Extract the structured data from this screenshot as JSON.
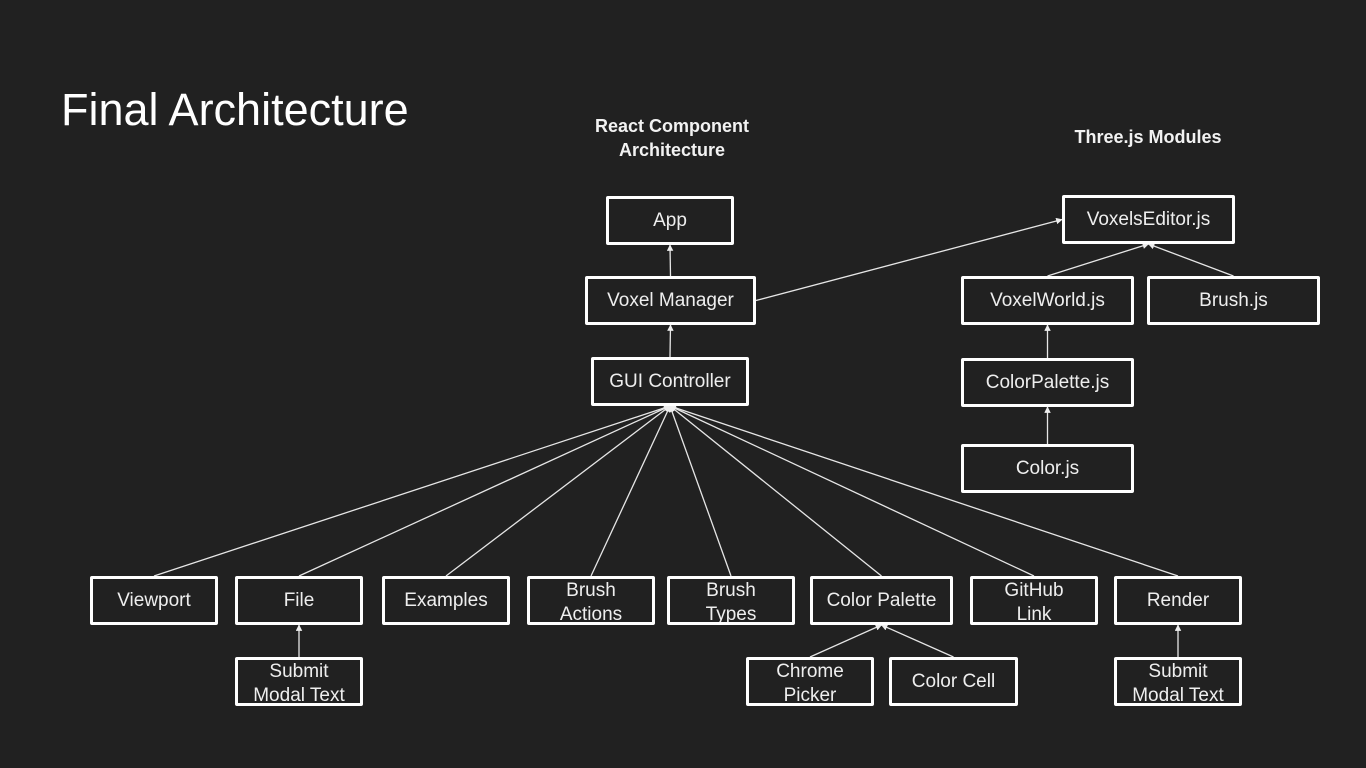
{
  "slide": {
    "title": "Final Architecture"
  },
  "sections": {
    "react": {
      "title_line1": "React Component",
      "title_line2": "Architecture"
    },
    "three": {
      "title": "Three.js Modules"
    }
  },
  "nodes": {
    "app": {
      "label": "App"
    },
    "voxel_manager": {
      "label": "Voxel Manager"
    },
    "gui_controller": {
      "label": "GUI Controller"
    },
    "viewport": {
      "label": "Viewport"
    },
    "file": {
      "label": "File"
    },
    "examples": {
      "label": "Examples"
    },
    "brush_actions": {
      "line1": "Brush",
      "line2": "Actions"
    },
    "brush_types": {
      "line1": "Brush",
      "line2": "Types"
    },
    "color_palette": {
      "label": "Color Palette"
    },
    "github_link": {
      "line1": "GitHub",
      "line2": "Link"
    },
    "render": {
      "label": "Render"
    },
    "submit_modal_file": {
      "line1": "Submit",
      "line2": "Modal Text"
    },
    "chrome_picker": {
      "line1": "Chrome",
      "line2": "Picker"
    },
    "color_cell": {
      "label": "Color Cell"
    },
    "submit_modal_render": {
      "line1": "Submit",
      "line2": "Modal Text"
    },
    "voxels_editor": {
      "label": "VoxelsEditor.js"
    },
    "voxel_world": {
      "label": "VoxelWorld.js"
    },
    "brush_js": {
      "label": "Brush.js"
    },
    "color_palette_js": {
      "label": "ColorPalette.js"
    },
    "color_js": {
      "label": "Color.js"
    }
  },
  "edges": [
    {
      "from": "voxel_manager",
      "to": "app"
    },
    {
      "from": "gui_controller",
      "to": "voxel_manager"
    },
    {
      "from": "voxel_manager",
      "to": "voxels_editor"
    },
    {
      "from": "viewport",
      "to": "gui_controller"
    },
    {
      "from": "file",
      "to": "gui_controller"
    },
    {
      "from": "examples",
      "to": "gui_controller"
    },
    {
      "from": "brush_actions",
      "to": "gui_controller"
    },
    {
      "from": "brush_types",
      "to": "gui_controller"
    },
    {
      "from": "color_palette",
      "to": "gui_controller"
    },
    {
      "from": "github_link",
      "to": "gui_controller"
    },
    {
      "from": "render",
      "to": "gui_controller"
    },
    {
      "from": "submit_modal_file",
      "to": "file"
    },
    {
      "from": "chrome_picker",
      "to": "color_palette"
    },
    {
      "from": "color_cell",
      "to": "color_palette"
    },
    {
      "from": "submit_modal_render",
      "to": "render"
    },
    {
      "from": "voxel_world",
      "to": "voxels_editor"
    },
    {
      "from": "brush_js",
      "to": "voxels_editor"
    },
    {
      "from": "color_palette_js",
      "to": "voxel_world"
    },
    {
      "from": "color_js",
      "to": "color_palette_js"
    }
  ]
}
